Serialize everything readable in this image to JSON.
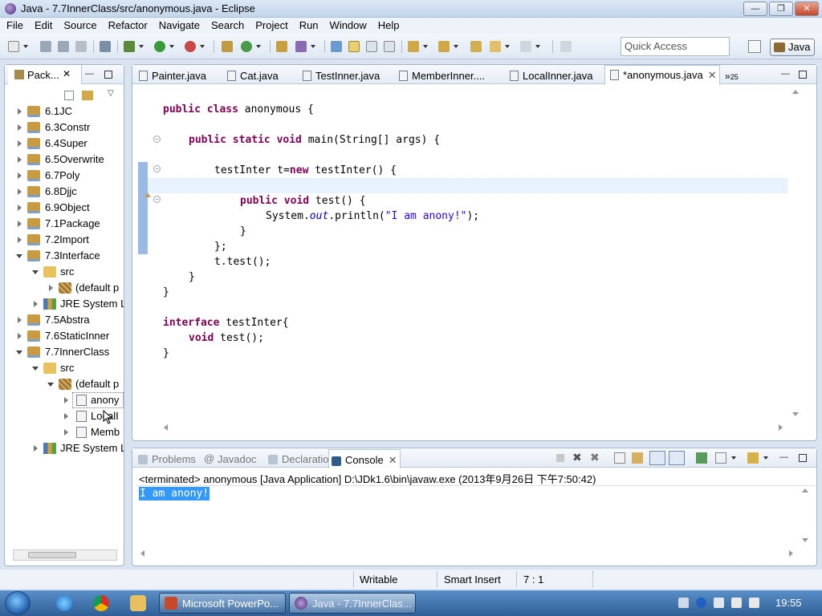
{
  "window": {
    "title": "Java - 7.7InnerClass/src/anonymous.java - Eclipse"
  },
  "menu": [
    "File",
    "Edit",
    "Source",
    "Refactor",
    "Navigate",
    "Search",
    "Project",
    "Run",
    "Window",
    "Help"
  ],
  "toolbar": {
    "quick_access_placeholder": "Quick Access",
    "perspective_label": "Java"
  },
  "package_explorer": {
    "tab_label": "Pack...",
    "tree": [
      {
        "label": "6.1JC"
      },
      {
        "label": "6.3Constr"
      },
      {
        "label": "6.4Super"
      },
      {
        "label": "6.5Overwrite"
      },
      {
        "label": "6.7Poly"
      },
      {
        "label": "6.8Djjc"
      },
      {
        "label": "6.9Object"
      },
      {
        "label": "7.1Package"
      },
      {
        "label": "7.2Import"
      },
      {
        "label": "7.3Interface"
      },
      {
        "label": "src"
      },
      {
        "label": "(default p"
      },
      {
        "label": "JRE System L"
      },
      {
        "label": "7.5Abstra"
      },
      {
        "label": "7.6StaticInner"
      },
      {
        "label": "7.7InnerClass"
      },
      {
        "label": "src"
      },
      {
        "label": "(default p"
      },
      {
        "label": "anony"
      },
      {
        "label": "LocalI"
      },
      {
        "label": "Memb"
      },
      {
        "label": "JRE System L"
      }
    ]
  },
  "editor": {
    "tabs": [
      "Painter.java",
      "Cat.java",
      "TestInner.java",
      "MemberInner....",
      "LocalInner.java",
      "*anonymous.java"
    ],
    "overflow_label": "25",
    "code": {
      "l1": {
        "kw": "public class",
        "rest": " anonymous {"
      },
      "l2": {
        "kw": "public static void",
        "rest": " main(String[] args) {"
      },
      "l3": {
        "pre": "testInter t=",
        "kw": "new",
        "rest": " testInter() {"
      },
      "l4": {
        "kw": "public void",
        "rest": " test() {"
      },
      "l5": {
        "pre": "System.",
        "it": "out",
        "mid": ".println(",
        "str": "\"I am anony!\"",
        "rest": ");"
      },
      "l6": "}",
      "l7": "};",
      "l8": "t.test();",
      "l9": "}",
      "l10": "}",
      "l11": {
        "kw": "interface",
        "rest": " testInter{"
      },
      "l12": {
        "kw": "void",
        "rest": " test();"
      },
      "l13": "}"
    }
  },
  "console": {
    "tabs": [
      "Problems",
      "Javadoc",
      "Declaration",
      "Console"
    ],
    "status": "<terminated> anonymous [Java Application] D:\\JDk1.6\\bin\\javaw.exe (2013年9月26日 下午7:50:42)",
    "output": "I am anony!"
  },
  "statusbar": {
    "writable": "Writable",
    "insert_mode": "Smart Insert",
    "position": "7 : 1"
  },
  "taskbar": {
    "buttons": [
      "Microsoft PowerPo...",
      "Java - 7.7InnerClas..."
    ],
    "clock": "19:55"
  }
}
